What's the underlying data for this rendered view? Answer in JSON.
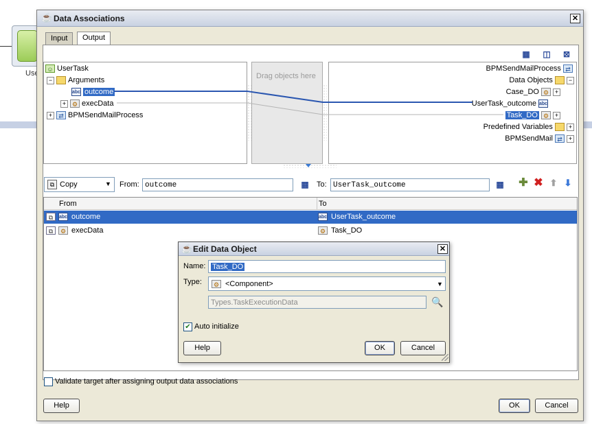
{
  "background": {
    "node_label": "Use"
  },
  "dialog": {
    "title": "Data Associations",
    "tabs": [
      {
        "label": "Input"
      },
      {
        "label": "Output"
      }
    ],
    "toolbar_icons": [
      "expression-builder-icon",
      "xml-icon",
      "expand-all-icon"
    ],
    "source_tree": {
      "items": [
        {
          "label": "UserTask",
          "icon": "task-icon"
        },
        {
          "label": "Arguments",
          "icon": "folder-icon"
        },
        {
          "label": "outcome",
          "icon": "string-icon"
        },
        {
          "label": "execData",
          "icon": "component-icon"
        },
        {
          "label": "BPMSendMailProcess",
          "icon": "process-icon"
        }
      ]
    },
    "drag_hint": "Drag objects here",
    "target_tree": {
      "items": [
        {
          "label": "BPMSendMailProcess",
          "icon": "process-icon"
        },
        {
          "label": "Data Objects",
          "icon": "folder-icon"
        },
        {
          "label": "Case_DO",
          "icon": "component-icon"
        },
        {
          "label": "UserTask_outcome",
          "icon": "string-icon"
        },
        {
          "label": "Task_DO",
          "icon": "component-icon"
        },
        {
          "label": "Predefined Variables",
          "icon": "folder-icon"
        },
        {
          "label": "BPMSendMail",
          "icon": "process-icon"
        }
      ]
    },
    "mapping": {
      "operation": "Copy",
      "from_label": "From:",
      "from_value": "outcome",
      "to_label": "To:",
      "to_value": "UserTask_outcome"
    },
    "grid": {
      "columns": [
        "From",
        "To"
      ],
      "rows": [
        {
          "from": "outcome",
          "to": "UserTask_outcome"
        },
        {
          "from": "execData",
          "to": "Task_DO"
        }
      ]
    },
    "validate_label": "Validate target after assigning output data associations",
    "help_label": "Help",
    "ok_label": "OK",
    "cancel_label": "Cancel"
  },
  "edit_dialog": {
    "title": "Edit Data Object",
    "name_label": "Name:",
    "name_value": "Task_DO",
    "type_label": "Type:",
    "type_value": "<Component>",
    "type_detail": "Types.TaskExecutionData",
    "auto_init_label": "Auto initialize",
    "auto_init_checked": true,
    "help_label": "Help",
    "ok_label": "OK",
    "cancel_label": "Cancel"
  },
  "colors": {
    "selection": "#316ac5",
    "mapping_line": "#2a56b0"
  }
}
